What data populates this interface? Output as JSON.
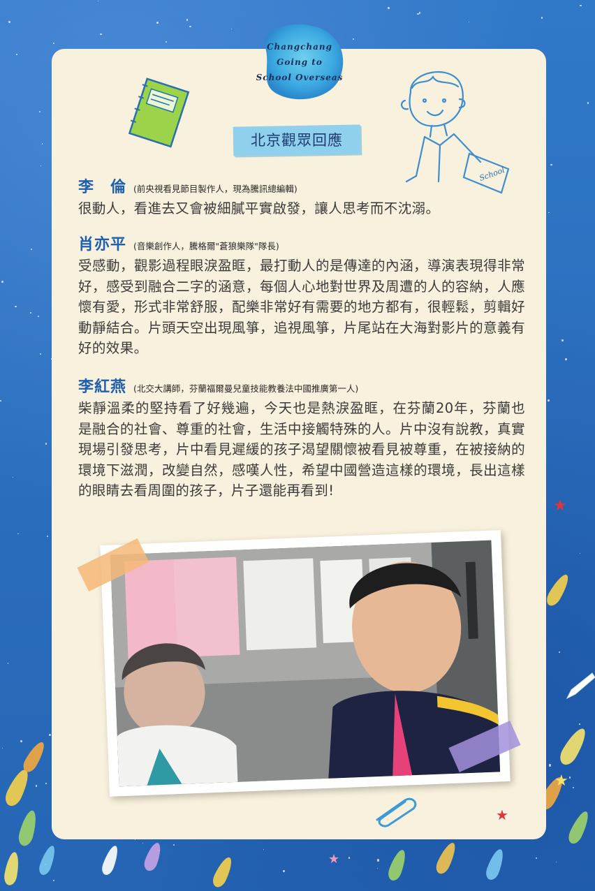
{
  "badge": {
    "line1": "Changchang",
    "line2": "Going to",
    "line3": "School Overseas"
  },
  "title": "北京觀眾回應",
  "sticker_label": "School",
  "reviews": [
    {
      "name": "李　倫",
      "role": "(前央視看見節目製作人，現為騰訊總編輯)",
      "text": "很動人，看進去又會被細膩平實啟發，讓人思考而不沈溺。"
    },
    {
      "name": "肖亦平",
      "role": "(音樂創作人，騰格爾\"蒼狼樂隊\"隊長)",
      "text": "受感動，觀影過程眼淚盈眶，最打動人的是傳達的內涵，導演表現得非常好，感受到融合二字的涵意，每個人心地對世界及周遭的人的容納，人應懷有愛，形式非常舒服，配樂非常好有需要的地方都有，很輕鬆，剪輯好動靜結合。片頭天空出現風箏，追視風箏，片尾站在大海對影片的意義有好的效果。"
    },
    {
      "name": "李紅燕",
      "role": "(北交大講師，芬蘭福爾曼兒童技能教養法中國推廣第一人)",
      "text": "柴靜溫柔的堅持看了好幾遍，今天也是熱淚盈眶，在芬蘭20年，芬蘭也是融合的社會、尊重的社會，生活中接觸特殊的人。片中沒有說教，真實現場引發思考，片中看見遲緩的孩子渴望關懷被看見被尊重，在被接納的環境下滋潤，改變自然，感嘆人性，希望中國營造這樣的環境，長出這樣的眼睛去看周圍的孩子，片子還能再看到!"
    }
  ],
  "colors": {
    "background": "#2a6fc0",
    "card": "#f8f1dd",
    "name": "#1f5fb0",
    "banner": "#8fd1ec"
  }
}
